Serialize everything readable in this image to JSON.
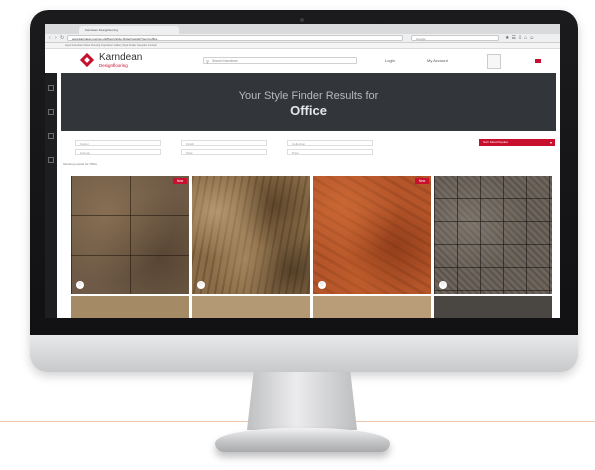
{
  "browser": {
    "tab_title": "Karndean Designflooring",
    "url": "www.karndean.com/en-gb/floors/style-finder/results?room=office",
    "search_placeholder": "Google",
    "bookmarks": "Apps  Karndean  News  Flooring  Inspiration  Gallery  Style Finder  Samples  Contact"
  },
  "site": {
    "logo_name": "Karndean",
    "logo_sub": "Designflooring",
    "search_placeholder": "Search Karndean",
    "login_label": "Login",
    "account_label": "My Account"
  },
  "hero": {
    "line1": "Your Style Finder Results for",
    "line2": "Office"
  },
  "filters": {
    "row1": [
      "Colour",
      "Finish",
      "Collection"
    ],
    "row2": [
      "Format",
      "Style",
      "Price"
    ],
    "sort_label": "Sort: Most Popular"
  },
  "results_text": "Showing results for Office",
  "tiles": [
    {
      "badge": "New",
      "texture": "slate"
    },
    {
      "badge": "",
      "texture": "stone"
    },
    {
      "badge": "New",
      "texture": "rust"
    },
    {
      "badge": "",
      "texture": "metal"
    }
  ],
  "colors": {
    "brand_red": "#c8102e",
    "hero_bg": "#323539"
  },
  "icons": [
    "search-icon",
    "heart-icon",
    "chevron-down-icon",
    "menu-icon"
  ]
}
